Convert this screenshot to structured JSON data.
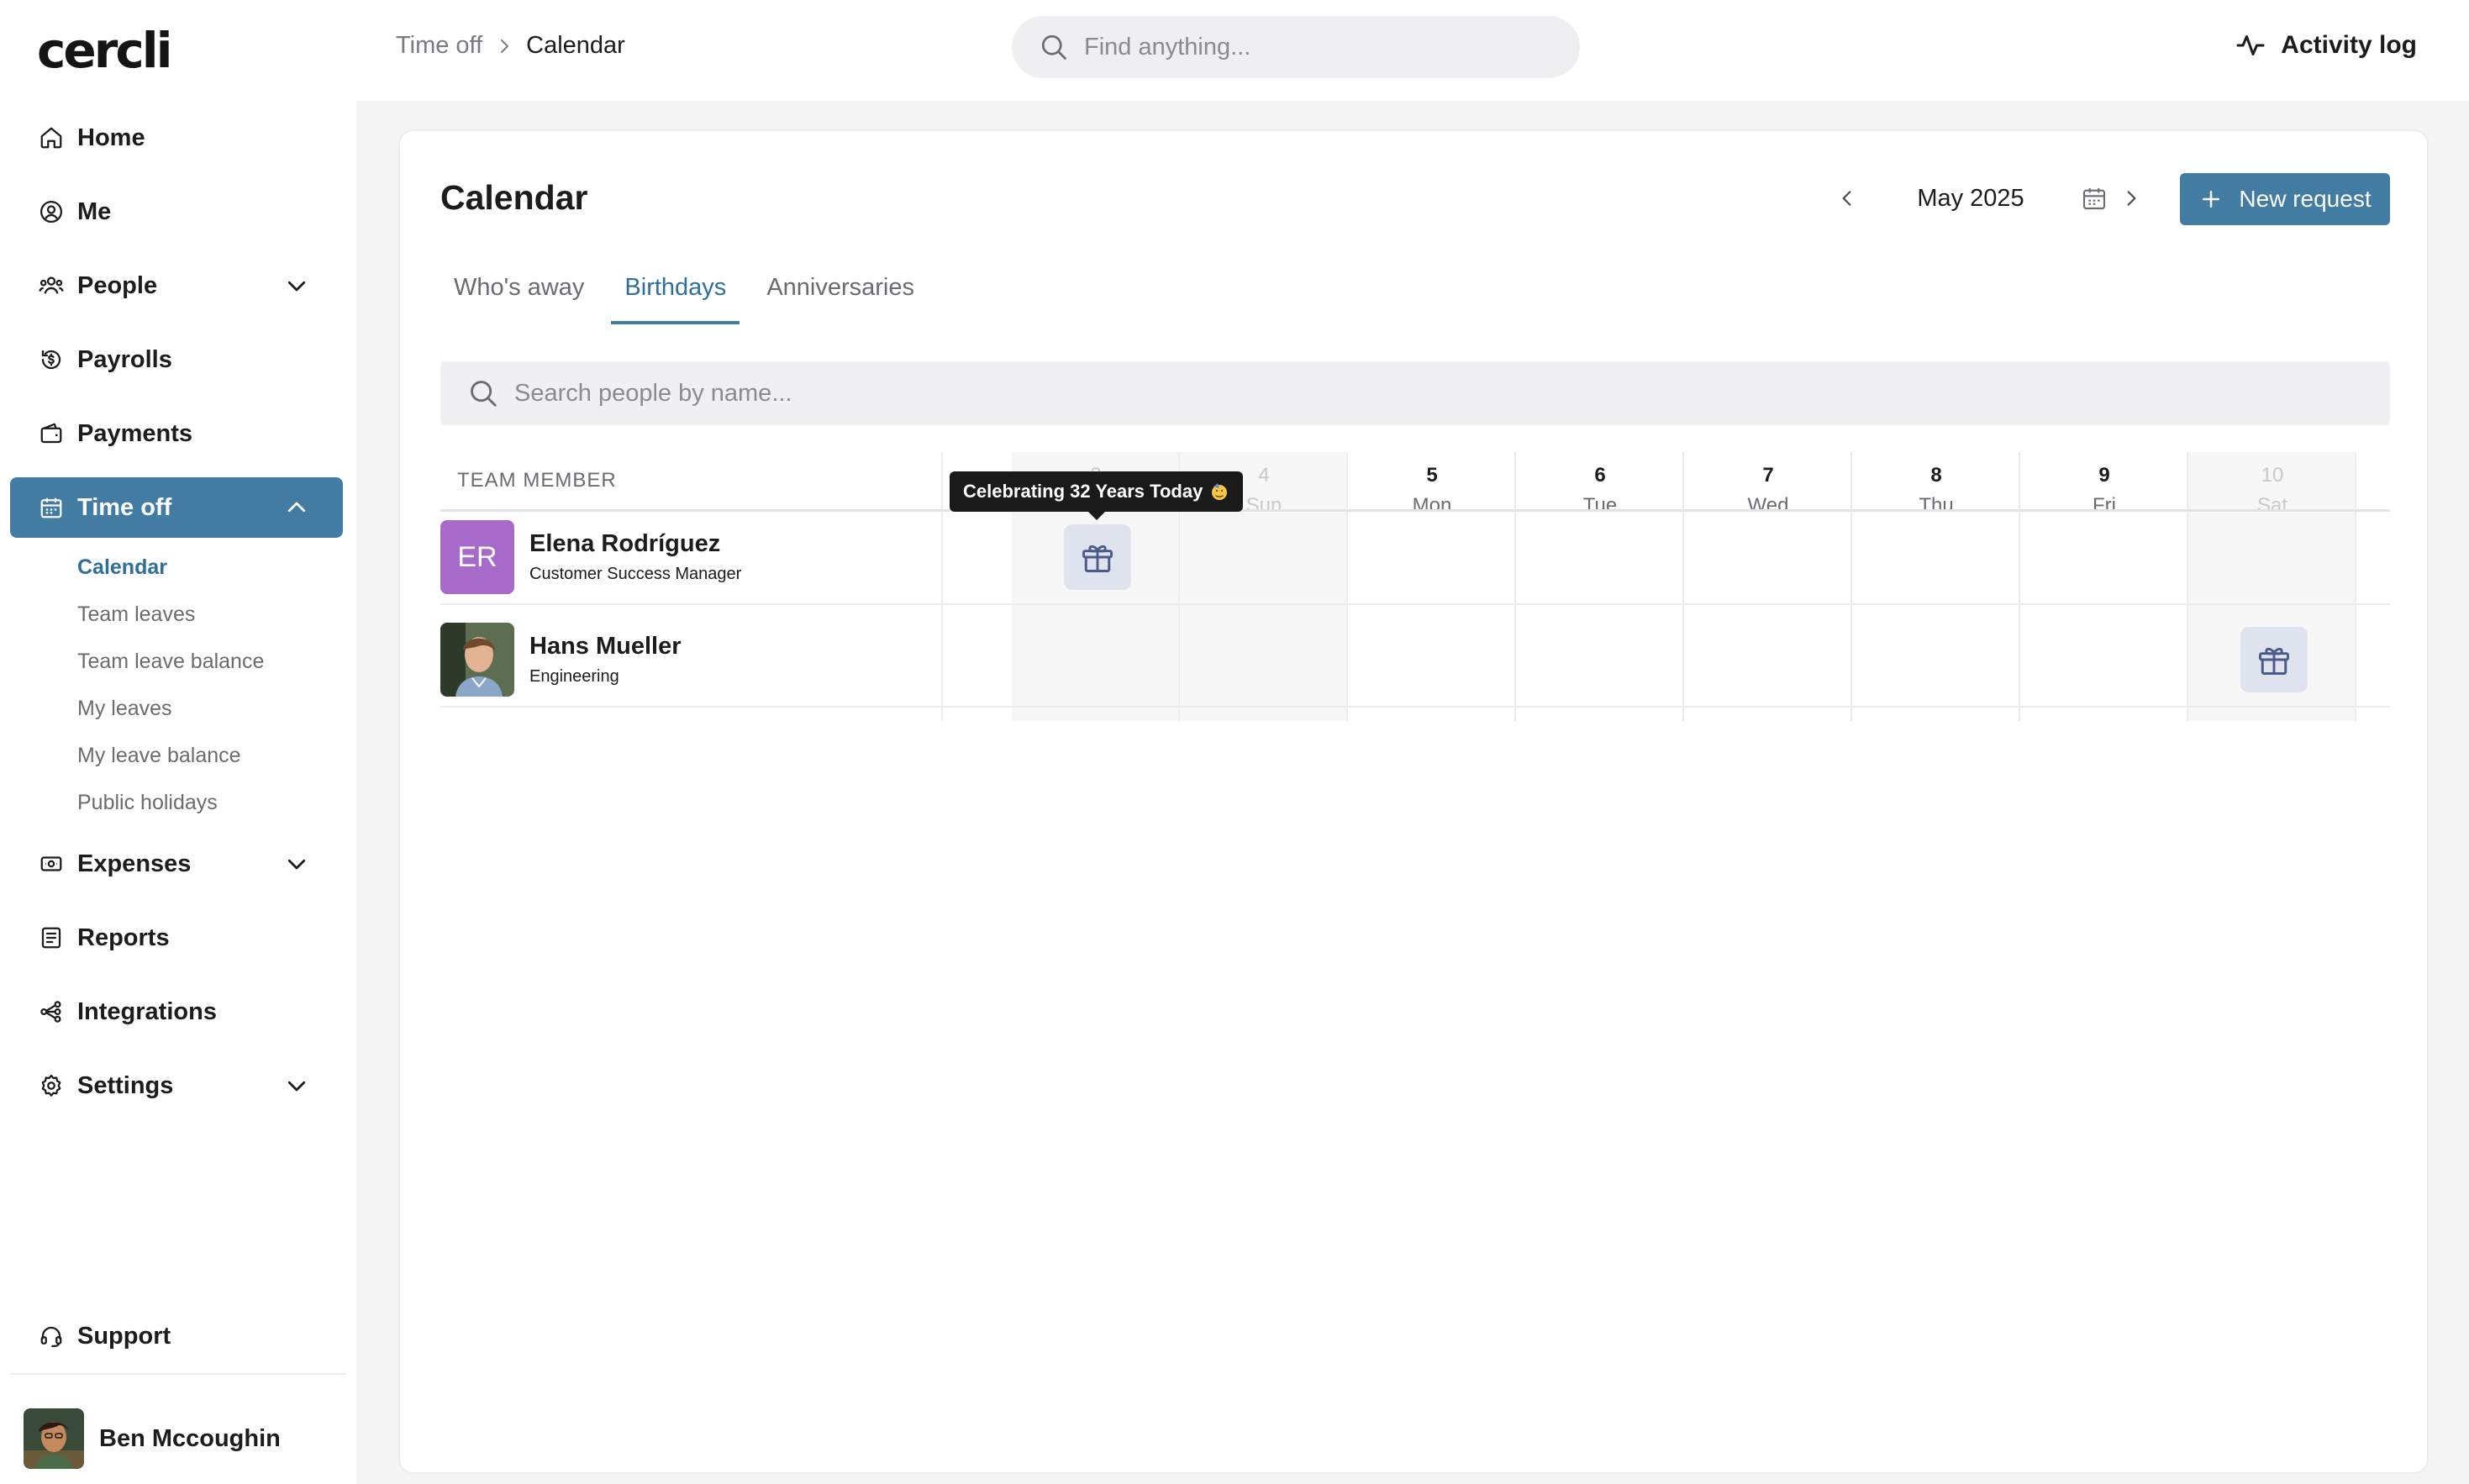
{
  "app": {
    "logo": "cercli"
  },
  "sidebar": {
    "items": [
      {
        "label": "Home",
        "icon": "home-icon"
      },
      {
        "label": "Me",
        "icon": "user-circle-icon"
      },
      {
        "label": "People",
        "icon": "people-icon",
        "expandable": true
      },
      {
        "label": "Payrolls",
        "icon": "payroll-icon"
      },
      {
        "label": "Payments",
        "icon": "wallet-icon"
      },
      {
        "label": "Time off",
        "icon": "calendar-icon",
        "expandable": true,
        "active": true
      },
      {
        "label": "Expenses",
        "icon": "receipt-icon",
        "expandable": true
      },
      {
        "label": "Reports",
        "icon": "report-icon"
      },
      {
        "label": "Integrations",
        "icon": "integrations-icon"
      },
      {
        "label": "Settings",
        "icon": "gear-icon",
        "expandable": true
      }
    ],
    "time_off_sub": [
      {
        "label": "Calendar",
        "active": true
      },
      {
        "label": "Team leaves"
      },
      {
        "label": "Team leave balance"
      },
      {
        "label": "My leaves"
      },
      {
        "label": "My leave balance"
      },
      {
        "label": "Public holidays"
      }
    ],
    "support": "Support",
    "user": {
      "name": "Ben Mccoughin"
    }
  },
  "topbar": {
    "breadcrumb": {
      "parent": "Time off",
      "current": "Calendar"
    },
    "search_placeholder": "Find anything...",
    "activity_log": "Activity log"
  },
  "page": {
    "title": "Calendar",
    "month": "May 2025",
    "new_request": "New request",
    "tabs": [
      {
        "label": "Who's away"
      },
      {
        "label": "Birthdays",
        "active": true
      },
      {
        "label": "Anniversaries"
      }
    ],
    "search_placeholder": "Search people by name..."
  },
  "calendar": {
    "member_header": "TEAM MEMBER",
    "days": [
      {
        "num": "3",
        "name": "Sat",
        "weekend": true
      },
      {
        "num": "4",
        "name": "Sun",
        "weekend": true
      },
      {
        "num": "5",
        "name": "Mon"
      },
      {
        "num": "6",
        "name": "Tue"
      },
      {
        "num": "7",
        "name": "Wed"
      },
      {
        "num": "8",
        "name": "Thu"
      },
      {
        "num": "9",
        "name": "Fri"
      },
      {
        "num": "10",
        "name": "Sat",
        "weekend": true
      }
    ],
    "members": [
      {
        "name": "Elena Rodríguez",
        "role": "Customer Success Manager",
        "initials": "ER",
        "avatar_color": "#a86ac8",
        "birthday_day": "3"
      },
      {
        "name": "Hans Mueller",
        "role": "Engineering",
        "birthday_day": "10"
      }
    ],
    "tooltip": "Celebrating 32 Years Today"
  },
  "colors": {
    "accent": "#427ca3",
    "accent_text": "#2f6f99",
    "gift_bg": "#dfe3ee"
  }
}
